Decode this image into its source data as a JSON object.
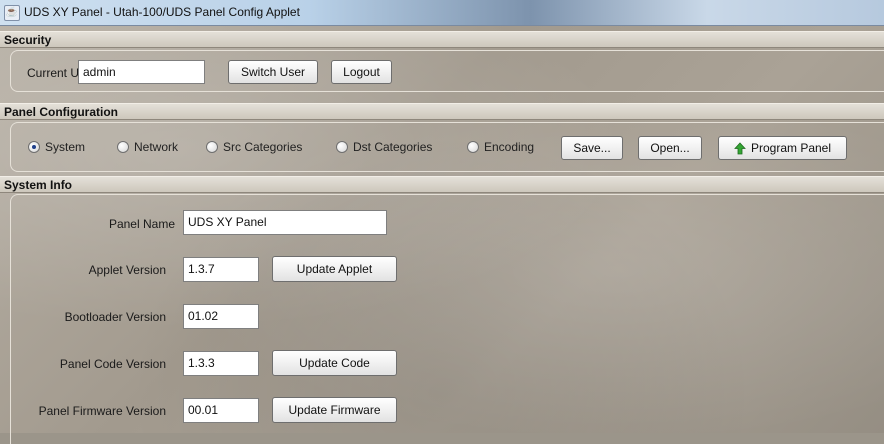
{
  "window": {
    "title": "UDS XY Panel - Utah-100/UDS Panel Config Applet",
    "icon": "java-icon"
  },
  "security": {
    "header": "Security",
    "current_user_label": "Current User",
    "current_user_value": "admin",
    "switch_user_label": "Switch User",
    "logout_label": "Logout"
  },
  "panel_config": {
    "header": "Panel Configuration",
    "options": [
      {
        "label": "System",
        "selected": true
      },
      {
        "label": "Network",
        "selected": false
      },
      {
        "label": "Src Categories",
        "selected": false
      },
      {
        "label": "Dst Categories",
        "selected": false
      },
      {
        "label": "Encoding",
        "selected": false
      }
    ],
    "save_label": "Save...",
    "open_label": "Open...",
    "program_label": "Program Panel",
    "program_icon": "green-up-arrow-icon",
    "program_icon_color": "#2e9a2e"
  },
  "system_info": {
    "header": "System Info",
    "panel_name_label": "Panel Name",
    "panel_name_value": "UDS XY Panel",
    "applet_version_label": "Applet Version",
    "applet_version_value": "1.3.7",
    "update_applet_label": "Update Applet",
    "bootloader_version_label": "Bootloader Version",
    "bootloader_version_value": "01.02",
    "panel_code_version_label": "Panel Code Version",
    "panel_code_version_value": "1.3.3",
    "update_code_label": "Update Code",
    "panel_firmware_version_label": "Panel Firmware Version",
    "panel_firmware_version_value": "00.01",
    "update_firmware_label": "Update Firmware"
  }
}
